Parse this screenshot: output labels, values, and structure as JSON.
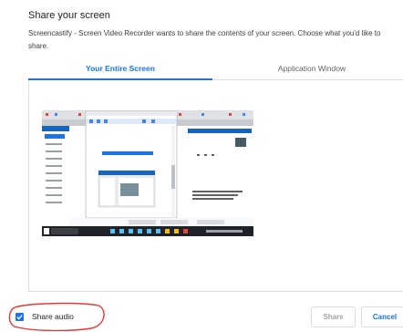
{
  "dialog": {
    "title": "Share your screen",
    "description_line1": "Screencastify - Screen Video Recorder wants to share the contents of your screen. Choose what you'd like to",
    "description_line2": "share."
  },
  "tabs": [
    {
      "label": "Your Entire Screen",
      "selected": true
    },
    {
      "label": "Application Window",
      "selected": false
    }
  ],
  "footer": {
    "share_audio_label": "Share audio",
    "share_audio_checked": true,
    "share_button": "Share",
    "cancel_button": "Cancel"
  },
  "colors": {
    "accent": "#1a73e8",
    "annotation": "#e53935"
  }
}
